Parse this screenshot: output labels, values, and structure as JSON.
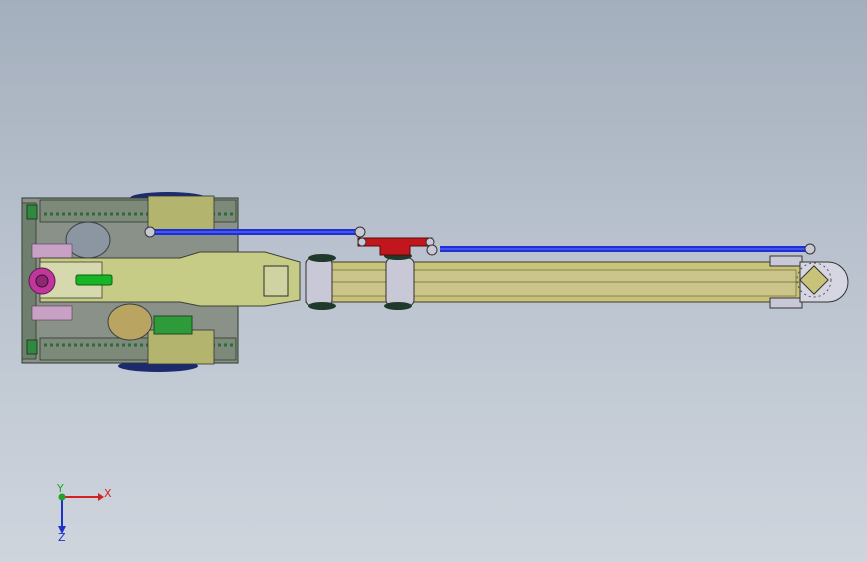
{
  "viewport": {
    "background_top": "#a4afbd",
    "background_bottom": "#cfd5dd"
  },
  "model": {
    "part_colors": {
      "chassis_frame": "#6f7f6e",
      "track": "#4b5a4a",
      "arm_body": "#c6cc86",
      "boom": "#c9c37a",
      "hydraulic_rod": "#1f2fd6",
      "bracket": "#c1161b",
      "shaft": "#16b526",
      "flange": "#c0379c",
      "wheel": "#1c2a6e",
      "joint_plate": "#c8c8d6"
    }
  },
  "triad": {
    "x_label": "X",
    "y_label": "Y",
    "z_label": "Z",
    "x_color": "#d42020",
    "y_color": "#1fa32b",
    "z_color": "#1c32c8"
  }
}
